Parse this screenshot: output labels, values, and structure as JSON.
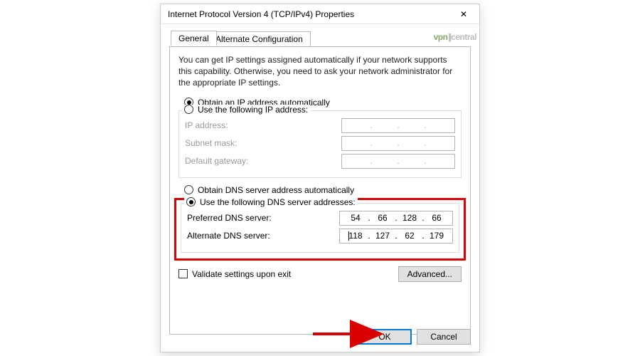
{
  "window": {
    "title": "Internet Protocol Version 4 (TCP/IPv4) Properties"
  },
  "watermark": {
    "left": "vpn",
    "right": "central"
  },
  "tabs": {
    "general": "General",
    "alt": "Alternate Configuration"
  },
  "intro": "You can get IP settings assigned automatically if your network supports this capability. Otherwise, you need to ask your network administrator for the appropriate IP settings.",
  "ip": {
    "auto_label": "Obtain an IP address automatically",
    "manual_label": "Use the following IP address:",
    "field_ip": "IP address:",
    "field_mask": "Subnet mask:",
    "field_gw": "Default gateway:"
  },
  "dns": {
    "auto_label": "Obtain DNS server address automatically",
    "manual_label": "Use the following DNS server addresses:",
    "pref_label": "Preferred DNS server:",
    "alt_label": "Alternate DNS server:",
    "pref_value": [
      "54",
      "66",
      "128",
      "66"
    ],
    "alt_value": [
      "118",
      "127",
      "62",
      "179"
    ]
  },
  "validate_label": "Validate settings upon exit",
  "buttons": {
    "advanced": "Advanced...",
    "ok": "OK",
    "cancel": "Cancel"
  }
}
